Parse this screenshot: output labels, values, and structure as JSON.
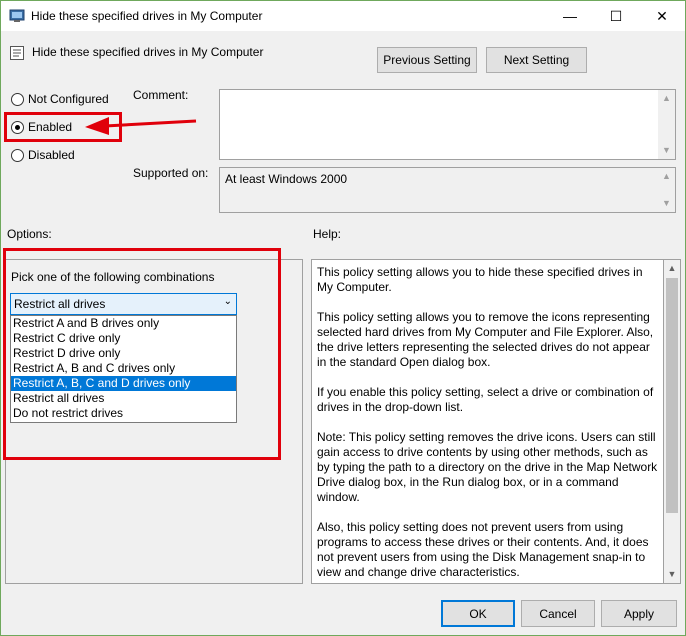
{
  "window": {
    "title": "Hide these specified drives in My Computer",
    "minimize_glyph": "—",
    "maximize_glyph": "☐",
    "close_glyph": "✕"
  },
  "header": {
    "policy_title": "Hide these specified drives in My Computer",
    "previous_setting": "Previous Setting",
    "next_setting": "Next Setting"
  },
  "state": {
    "options": [
      {
        "label": "Not Configured",
        "checked": false
      },
      {
        "label": "Enabled",
        "checked": true
      },
      {
        "label": "Disabled",
        "checked": false
      }
    ]
  },
  "comment": {
    "label": "Comment:",
    "value": ""
  },
  "supported": {
    "label": "Supported on:",
    "value": "At least Windows 2000"
  },
  "options_panel": {
    "heading": "Options:",
    "prompt": "Pick one of the following combinations",
    "selected_value": "Restrict all drives",
    "dropdown_options": [
      "Restrict A and B drives only",
      "Restrict C drive only",
      "Restrict D drive only",
      "Restrict A, B and C drives only",
      "Restrict A, B, C and D drives only",
      "Restrict all drives",
      "Do not restrict drives"
    ],
    "highlighted_option_index": 4
  },
  "help_panel": {
    "heading": "Help:",
    "paragraphs": [
      "This policy setting allows you to hide these specified drives in My Computer.",
      "This policy setting allows you to remove the icons representing selected hard drives from My Computer and File Explorer. Also, the drive letters representing the selected drives do not appear in the standard Open dialog box.",
      "If you enable this policy setting, select a drive or combination of drives in the drop-down list.",
      "Note: This policy setting removes the drive icons. Users can still gain access to drive contents by using other methods, such as by typing the path to a directory on the drive in the Map Network Drive dialog box, in the Run dialog box, or in a command window.",
      "Also, this policy setting does not prevent users from using programs to access these drives or their contents. And, it does not prevent users from using the Disk Management snap-in to view and change drive characteristics."
    ]
  },
  "footer": {
    "ok": "OK",
    "cancel": "Cancel",
    "apply": "Apply"
  },
  "colors": {
    "annotation_red": "#e0000b",
    "selection_blue": "#0078d7"
  }
}
